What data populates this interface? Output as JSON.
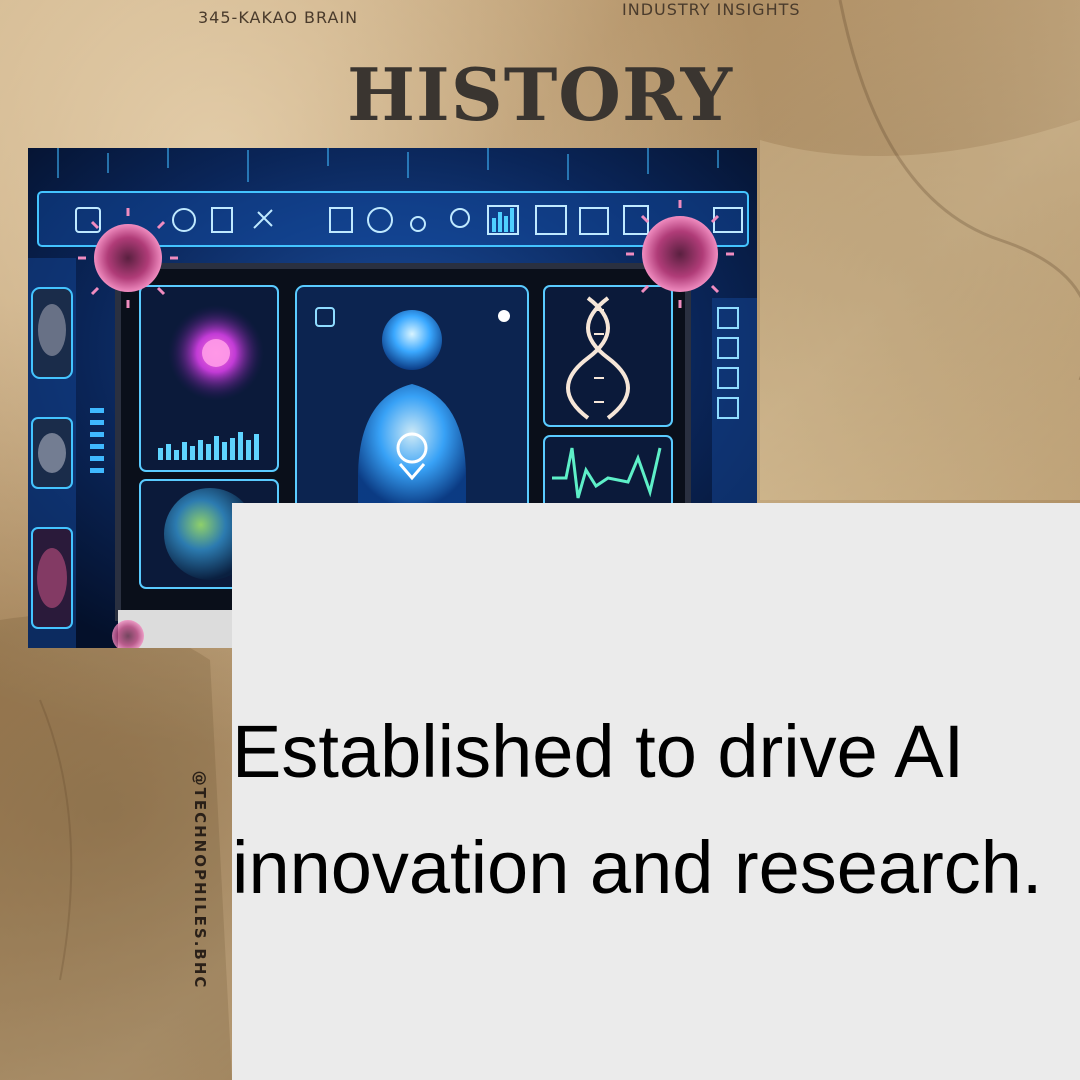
{
  "header": {
    "left_label": "345-KAKAO BRAIN",
    "right_label": "INDUSTRY INSIGHTS"
  },
  "title": "HISTORY",
  "hero_image": {
    "icon": "ai-healthcare-dashboard-illustration"
  },
  "body_text": "Established to drive AI innovation and research.",
  "handle": "@TECHNOPHILES.BHC",
  "colors": {
    "paper": "#c4a67a",
    "panel": "#ebebeb",
    "title": "#3a3530",
    "neon": "#2fb8ff",
    "virus": "#e06aa8"
  }
}
